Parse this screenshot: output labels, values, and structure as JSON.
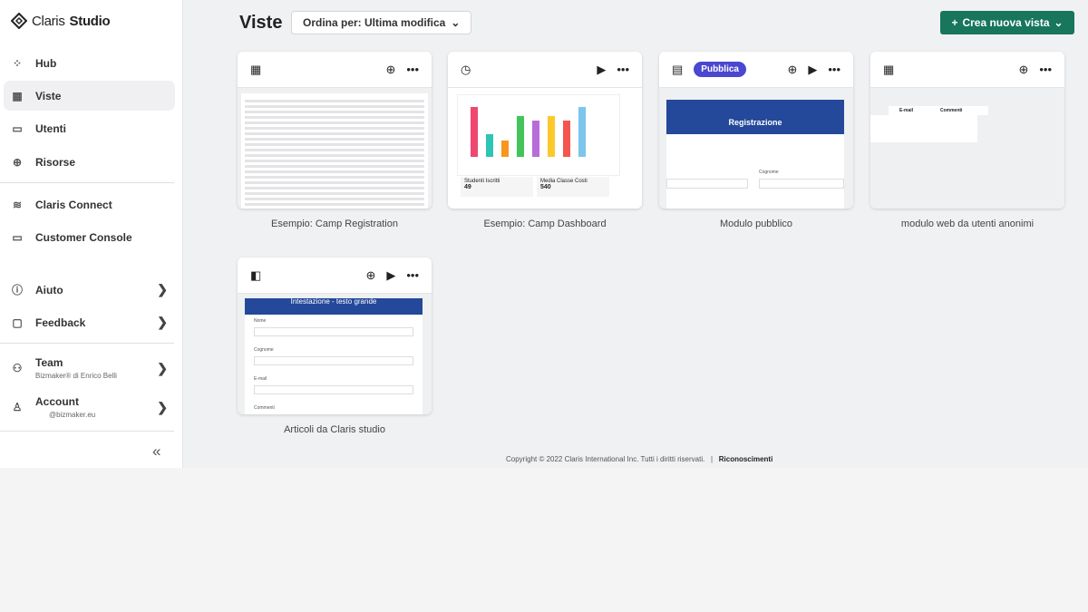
{
  "app": {
    "logo_light": "Claris",
    "logo_bold": "Studio"
  },
  "sidebar": {
    "items": [
      {
        "label": "Hub",
        "icon": "hub-icon"
      },
      {
        "label": "Viste",
        "icon": "grid-icon"
      },
      {
        "label": "Utenti",
        "icon": "id-card-icon"
      },
      {
        "label": "Risorse",
        "icon": "download-icon"
      },
      {
        "label": "Claris Connect",
        "icon": "rss-icon"
      },
      {
        "label": "Customer Console",
        "icon": "window-icon"
      },
      {
        "label": "Aiuto",
        "icon": "info-icon"
      },
      {
        "label": "Feedback",
        "icon": "chat-icon"
      },
      {
        "label": "Team",
        "sub": "Bizmaker® di Enrico Belli",
        "icon": "team-icon"
      },
      {
        "label": "Account",
        "sub": "@bizmaker.eu",
        "icon": "user-icon"
      }
    ]
  },
  "header": {
    "title": "Viste",
    "sort_label": "Ordina per: Ultima modifica",
    "create_label": "Crea nuova vista"
  },
  "cards": [
    {
      "label": "Esempio: Camp Registration",
      "type": "table"
    },
    {
      "label": "Esempio: Camp Dashboard",
      "type": "dashboard"
    },
    {
      "label": "Modulo pubblico",
      "type": "form",
      "badge": "Pubblica"
    },
    {
      "label": "modulo web da utenti anonimi",
      "type": "table"
    },
    {
      "label": "Articoli da Claris studio",
      "type": "form"
    }
  ],
  "previews": {
    "dash_kpi1_label": "Studenti Iscritti",
    "dash_kpi1": "49",
    "dash_kpi2_label": "Media Classe Costi",
    "dash_kpi2": "540",
    "form_banner": "Registrazione",
    "form_field": "Cognome",
    "art_banner": "Intestazione - testo grande",
    "art_f1": "Nome",
    "art_f2": "Cognome",
    "art_f3": "E-mail",
    "art_f4": "Commenti",
    "tbl_col1": "E-mail",
    "tbl_col2": "Commenti"
  },
  "footer": {
    "copyright": "Copyright © 2022 Claris International Inc. Tutti i diritti riservati.",
    "sep": "|",
    "link": "Riconoscimenti"
  },
  "colors": {
    "accent": "#17765c",
    "badge": "#4a47d0"
  }
}
